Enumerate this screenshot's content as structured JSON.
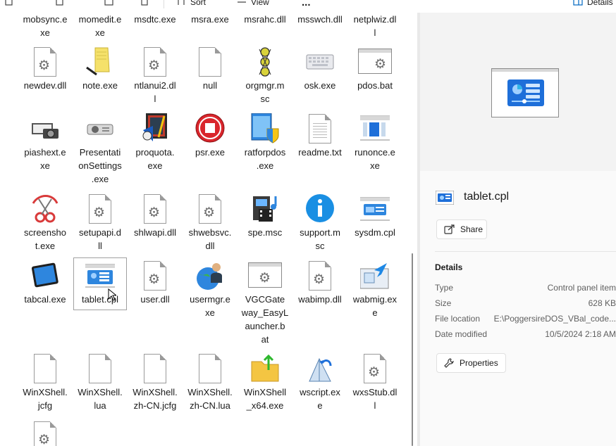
{
  "toolbar": {
    "sort_label": "Sort",
    "view_label": "View",
    "more_label": "...",
    "details_label": "Details"
  },
  "files": [
    {
      "name": "mobsync.exe",
      "lines": [
        "mobsync.e",
        "xe"
      ],
      "icon": "generic-exe-icon"
    },
    {
      "name": "momedit.exe",
      "lines": [
        "momedit.e",
        "xe"
      ],
      "icon": "generic-exe-icon"
    },
    {
      "name": "msdtc.exe",
      "lines": [
        "msdtc.exe"
      ],
      "icon": "generic-exe-icon"
    },
    {
      "name": "msra.exe",
      "lines": [
        "msra.exe"
      ],
      "icon": "generic-exe-icon"
    },
    {
      "name": "msrahc.dll",
      "lines": [
        "msrahc.dll"
      ],
      "icon": "dll-icon"
    },
    {
      "name": "msswch.dll",
      "lines": [
        "msswch.dll"
      ],
      "icon": "dll-icon"
    },
    {
      "name": "netplwiz.dll",
      "lines": [
        "netplwiz.dl",
        "l"
      ],
      "icon": "dll-icon"
    },
    {
      "name": "newdev.dll",
      "lines": [
        "newdev.dll"
      ],
      "icon": "dll-gear-icon"
    },
    {
      "name": "note.exe",
      "lines": [
        "note.exe"
      ],
      "icon": "notepad-icon"
    },
    {
      "name": "ntlanui2.dll",
      "lines": [
        "ntlanui2.dl",
        "l"
      ],
      "icon": "dll-gear-icon"
    },
    {
      "name": "null",
      "lines": [
        "null"
      ],
      "icon": "blank-file-icon"
    },
    {
      "name": "orgmgr.msc",
      "lines": [
        "orgmgr.m",
        "sc"
      ],
      "icon": "org-manager-icon"
    },
    {
      "name": "osk.exe",
      "lines": [
        "osk.exe"
      ],
      "icon": "keyboard-icon"
    },
    {
      "name": "pdos.bat",
      "lines": [
        "pdos.bat"
      ],
      "icon": "batch-file-icon"
    },
    {
      "name": "piashext.exe",
      "lines": [
        "piashext.e",
        "xe"
      ],
      "icon": "camera-icon"
    },
    {
      "name": "PresentationSettings.exe",
      "lines": [
        "Presentati",
        "onSettings",
        ".exe"
      ],
      "icon": "projector-icon"
    },
    {
      "name": "proquota.exe",
      "lines": [
        "proquota.",
        "exe"
      ],
      "icon": "proquota-icon"
    },
    {
      "name": "psr.exe",
      "lines": [
        "psr.exe"
      ],
      "icon": "stop-record-icon"
    },
    {
      "name": "ratforpdos.exe",
      "lines": [
        "ratforpdos",
        ".exe"
      ],
      "icon": "shield-window-icon"
    },
    {
      "name": "readme.txt",
      "lines": [
        "readme.txt"
      ],
      "icon": "text-file-icon"
    },
    {
      "name": "runonce.exe",
      "lines": [
        "runonce.e",
        "xe"
      ],
      "icon": "window-app-icon"
    },
    {
      "name": "screenshot.exe",
      "lines": [
        "screensho",
        "t.exe"
      ],
      "icon": "snipping-icon"
    },
    {
      "name": "setupapi.dll",
      "lines": [
        "setupapi.d",
        "ll"
      ],
      "icon": "dll-gear-icon"
    },
    {
      "name": "shlwapi.dll",
      "lines": [
        "shlwapi.dll"
      ],
      "icon": "dll-gear-icon"
    },
    {
      "name": "shwebsvc.dll",
      "lines": [
        "shwebsvc.",
        "dll"
      ],
      "icon": "dll-gear-icon"
    },
    {
      "name": "spe.msc",
      "lines": [
        "spe.msc"
      ],
      "icon": "media-console-icon"
    },
    {
      "name": "support.msc",
      "lines": [
        "support.m",
        "sc"
      ],
      "icon": "info-icon"
    },
    {
      "name": "sysdm.cpl",
      "lines": [
        "sysdm.cpl"
      ],
      "icon": "control-panel-icon"
    },
    {
      "name": "tabcal.exe",
      "lines": [
        "tabcal.exe"
      ],
      "icon": "tablet-icon"
    },
    {
      "name": "tablet.cpl",
      "lines": [
        "tablet.cpl"
      ],
      "icon": "tablet-settings-icon",
      "selected": true
    },
    {
      "name": "user.dll",
      "lines": [
        "user.dll"
      ],
      "icon": "dll-gear-icon"
    },
    {
      "name": "usermgr.exe",
      "lines": [
        "usermgr.e",
        "xe"
      ],
      "icon": "user-globe-icon"
    },
    {
      "name": "VGCGateway_EasyLauncher.bat",
      "lines": [
        "VGCGate",
        "way_EasyL",
        "auncher.b",
        "at"
      ],
      "icon": "batch-file-icon"
    },
    {
      "name": "wabimp.dll",
      "lines": [
        "wabimp.dll"
      ],
      "icon": "dll-gear-icon"
    },
    {
      "name": "wabmig.exe",
      "lines": [
        "wabmig.ex",
        "e"
      ],
      "icon": "address-book-icon"
    },
    {
      "name": "WinXShell.jcfg",
      "lines": [
        "WinXShell.",
        "jcfg"
      ],
      "icon": "blank-file-icon"
    },
    {
      "name": "WinXShell.lua",
      "lines": [
        "WinXShell.",
        "lua"
      ],
      "icon": "blank-file-icon"
    },
    {
      "name": "WinXShell.zh-CN.jcfg",
      "lines": [
        "WinXShell.",
        "zh-CN.jcfg"
      ],
      "icon": "blank-file-icon"
    },
    {
      "name": "WinXShell.zh-CN.lua",
      "lines": [
        "WinXShell.",
        "zh-CN.lua"
      ],
      "icon": "blank-file-icon"
    },
    {
      "name": "WinXShell_x64.exe",
      "lines": [
        "WinXShell",
        "_x64.exe"
      ],
      "icon": "folder-arrow-icon"
    },
    {
      "name": "wscript.exe",
      "lines": [
        "wscript.ex",
        "e"
      ],
      "icon": "script-icon"
    },
    {
      "name": "wxsStub.dll",
      "lines": [
        "wxsStub.dl",
        "l"
      ],
      "icon": "dll-gear-icon"
    },
    {
      "name": "",
      "lines": [],
      "icon": "dll-gear-icon"
    }
  ],
  "details": {
    "file_name": "tablet.cpl",
    "share_label": "Share",
    "section_title": "Details",
    "rows": [
      {
        "key": "Type",
        "value": "Control panel item"
      },
      {
        "key": "Size",
        "value": "628 KB"
      },
      {
        "key": "File location",
        "value": "E:\\PoggersireDOS_VBal_code..."
      },
      {
        "key": "Date modified",
        "value": "10/5/2024 2:18 AM"
      }
    ],
    "properties_label": "Properties"
  },
  "colors": {
    "accent": "#0067c0",
    "panel_bg": "#fafafa",
    "selection_border": "#a0a0a0"
  }
}
